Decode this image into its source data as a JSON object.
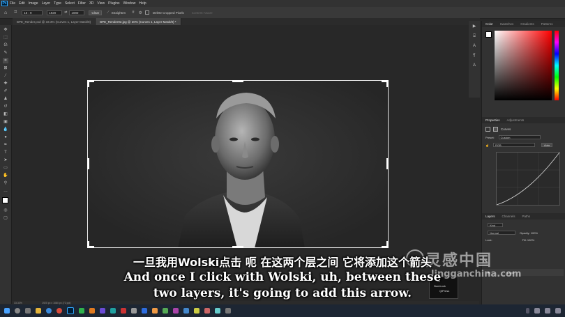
{
  "menubar": {
    "app_logo": "Ps",
    "items": [
      "File",
      "Edit",
      "Image",
      "Layer",
      "Type",
      "Select",
      "Filter",
      "3D",
      "View",
      "Plugins",
      "Window",
      "Help"
    ]
  },
  "options": {
    "ratio": "16 : 9",
    "width": "1920",
    "height": "1080",
    "clear_label": "Clear",
    "straighten_label": "Straighten",
    "delete_cropped_label": "Delete Cropped Pixels",
    "content_aware_label": "Content-Aware"
  },
  "tabs": [
    {
      "label": "BPE_Render.psd @ 33.3% (Curves 1, Layer Mask/8)"
    },
    {
      "label": "BPE_Render02.jpg @ 20% (Curves 1, Layer Mask/8) *"
    }
  ],
  "status": {
    "zoom": "33.33%",
    "doc": "1920 px x 1080 px (72 ppi)"
  },
  "panels": {
    "color_tabs": [
      "Color",
      "Swatches",
      "Gradients",
      "Patterns"
    ],
    "properties_tabs": [
      "Properties",
      "Adjustments"
    ],
    "properties_title": "Curves",
    "preset_label": "Preset:",
    "preset_value": "Custom",
    "channel_value": "RGB",
    "auto_label": "Auto",
    "layers_tabs": [
      "Layers",
      "Channels",
      "Paths"
    ],
    "kind_label": "Kind",
    "blend_mode": "Normal",
    "opacity_label": "Opacity: 100%",
    "lock_label": "Lock:",
    "fill_label": "Fill: 100%",
    "layer_name": "Layer"
  },
  "tooltip": {
    "title": "Alt",
    "line1": "NumLock",
    "line2": "QiPress"
  },
  "subtitles": {
    "cn": "一旦我用Wolski点击 呃 在这两个层之间 它将添加这个箭头",
    "en1": "And once I click with Wolski, uh, between these",
    "en2": "two layers, it's going to add this arrow."
  },
  "watermark": {
    "cn": "灵感中国",
    "url": "lingganchina.com"
  },
  "colors": {
    "accent": "#31a8ff",
    "panel": "#323232",
    "canvas": "#282828"
  }
}
